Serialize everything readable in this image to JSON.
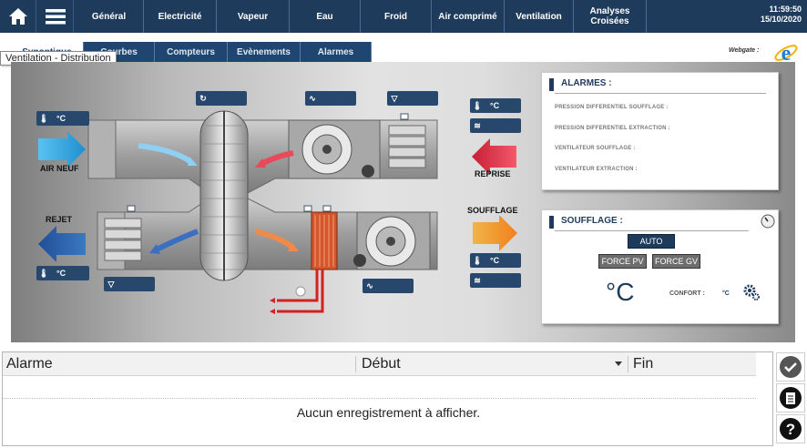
{
  "nav": {
    "items": [
      {
        "label": "Général",
        "width": 76
      },
      {
        "label": "Electricité",
        "width": 80
      },
      {
        "label": "Vapeur",
        "width": 80
      },
      {
        "label": "Eau",
        "width": 78
      },
      {
        "label": "Froid",
        "width": 78
      },
      {
        "label": "Air comprimé",
        "width": 80
      },
      {
        "label": "Ventilation",
        "width": 76
      },
      {
        "label": "Analyses\nCroisées",
        "width": 80
      }
    ],
    "time": "11:59:50",
    "date": "15/10/2020"
  },
  "subtabs": [
    {
      "label": "Synoptique",
      "active": true,
      "width": 80
    },
    {
      "label": "Courbes",
      "active": false,
      "width": 78
    },
    {
      "label": "Compteurs",
      "active": false,
      "width": 80
    },
    {
      "label": "Evènements",
      "active": false,
      "width": 80
    },
    {
      "label": "Alarmes",
      "active": false,
      "width": 78
    }
  ],
  "tooltip": "Ventilation - Distribution",
  "webgate_label": "Webgate :",
  "diagram": {
    "air_neuf": "AIR NEUF",
    "rejet": "REJET",
    "reprise": "REPRISE",
    "soufflage": "SOUFFLAGE",
    "unit_c": "°C"
  },
  "alarmes_card": {
    "title": "ALARMES :",
    "items": [
      "PRESSION DIFFERENTIEL SOUFFLAGE :",
      "PRESSION DIFFERENTIEL EXTRACTION :",
      "VENTILATEUR SOUFFLAGE :",
      "VENTILATEUR EXTRACTION :"
    ]
  },
  "soufflage_card": {
    "title": "SOUFFLAGE :",
    "auto_label": "AUTO",
    "force_pv_label": "FORCE PV",
    "force_gv_label": "FORCE GV",
    "big_unit": "°C",
    "confort_label": "CONFORT :",
    "confort_unit": "°C"
  },
  "grid": {
    "columns": [
      "Alarme",
      "Début",
      "Fin"
    ],
    "empty_message": "Aucun enregistrement à afficher."
  },
  "colors": {
    "nav_bg": "#1f3b5c",
    "arrow_blue": "#2b9ed8",
    "arrow_red": "#e8394a",
    "arrow_orange": "#f39c2b"
  }
}
